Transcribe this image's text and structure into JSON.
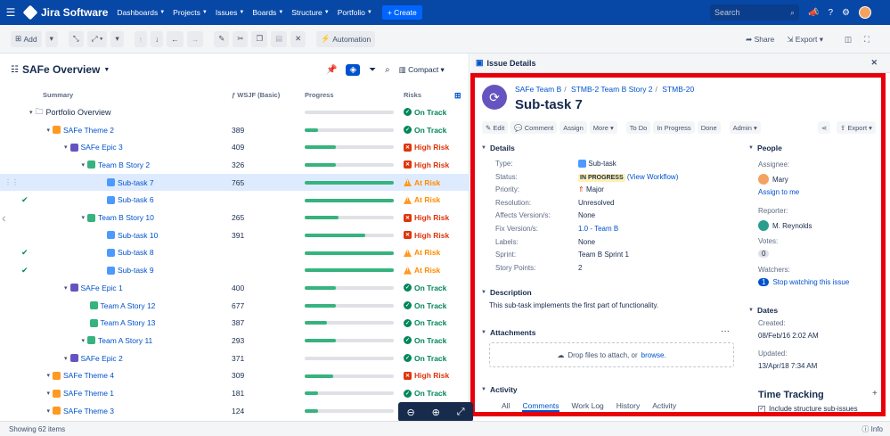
{
  "nav": {
    "brand": "Jira Software",
    "items": [
      "Dashboards",
      "Projects",
      "Issues",
      "Boards",
      "Structure",
      "Portfolio"
    ],
    "create": "+ Create",
    "search_placeholder": "Search"
  },
  "toolbar": {
    "add": "Add",
    "automation": "Automation",
    "share": "Share",
    "export": "Export"
  },
  "structure": {
    "title": "SAFe Overview",
    "view": "Compact",
    "columns": {
      "summary": "Summary",
      "wsjf": "WSJF (Basic)",
      "progress": "Progress",
      "risks": "Risks"
    },
    "rows": [
      {
        "type": "folder",
        "summary": "Portfolio Overview",
        "wsjf": "",
        "progress": 0.0,
        "risk": "On Track",
        "risk_kind": "on",
        "check": false,
        "level": 0,
        "twisty": true
      },
      {
        "type": "theme",
        "summary": "SAFe Theme 2",
        "wsjf": "389",
        "progress": 0.15,
        "risk": "On Track",
        "risk_kind": "on",
        "check": false,
        "level": 1,
        "twisty": true
      },
      {
        "type": "epic",
        "summary": "SAFe Epic 3",
        "wsjf": "409",
        "progress": 0.35,
        "risk": "High Risk",
        "risk_kind": "high",
        "check": false,
        "level": 2,
        "twisty": true
      },
      {
        "type": "story",
        "summary": "Team B Story 2",
        "wsjf": "326",
        "progress": 0.35,
        "risk": "High Risk",
        "risk_kind": "high",
        "check": false,
        "level": 3,
        "twisty": true
      },
      {
        "type": "sub",
        "summary": "Sub-task 7",
        "wsjf": "765",
        "progress": 1.0,
        "risk": "At Risk",
        "risk_kind": "at",
        "check": false,
        "level": 4,
        "twisty": false,
        "selected": true
      },
      {
        "type": "sub",
        "summary": "Sub-task 6",
        "wsjf": "",
        "progress": 1.0,
        "risk": "At Risk",
        "risk_kind": "at",
        "check": true,
        "level": 4,
        "twisty": false
      },
      {
        "type": "story",
        "summary": "Team B Story 10",
        "wsjf": "265",
        "progress": 0.38,
        "risk": "High Risk",
        "risk_kind": "high",
        "check": false,
        "level": 3,
        "twisty": true
      },
      {
        "type": "sub",
        "summary": "Sub-task 10",
        "wsjf": "391",
        "progress": 0.68,
        "risk": "High Risk",
        "risk_kind": "high",
        "check": false,
        "level": 4,
        "twisty": false
      },
      {
        "type": "sub",
        "summary": "Sub-task 8",
        "wsjf": "",
        "progress": 1.0,
        "risk": "At Risk",
        "risk_kind": "at",
        "check": true,
        "level": 4,
        "twisty": false
      },
      {
        "type": "sub",
        "summary": "Sub-task 9",
        "wsjf": "",
        "progress": 1.0,
        "risk": "At Risk",
        "risk_kind": "at",
        "check": true,
        "level": 4,
        "twisty": false
      },
      {
        "type": "epic",
        "summary": "SAFe Epic 1",
        "wsjf": "400",
        "progress": 0.35,
        "risk": "On Track",
        "risk_kind": "on",
        "check": false,
        "level": 2,
        "twisty": true
      },
      {
        "type": "story",
        "summary": "Team A Story 12",
        "wsjf": "677",
        "progress": 0.35,
        "risk": "On Track",
        "risk_kind": "on",
        "check": false,
        "level": 3,
        "twisty": false
      },
      {
        "type": "story",
        "summary": "Team A Story 13",
        "wsjf": "387",
        "progress": 0.25,
        "risk": "On Track",
        "risk_kind": "on",
        "check": false,
        "level": 3,
        "twisty": false
      },
      {
        "type": "story",
        "summary": "Team A Story 11",
        "wsjf": "293",
        "progress": 0.35,
        "risk": "On Track",
        "risk_kind": "on",
        "check": false,
        "level": 3,
        "twisty": true
      },
      {
        "type": "epic",
        "summary": "SAFe Epic 2",
        "wsjf": "371",
        "progress": 0.0,
        "risk": "On Track",
        "risk_kind": "on",
        "check": false,
        "level": 2,
        "twisty": true
      },
      {
        "type": "theme",
        "summary": "SAFe Theme 4",
        "wsjf": "309",
        "progress": 0.32,
        "risk": "High Risk",
        "risk_kind": "high",
        "check": false,
        "level": 1,
        "twisty": true
      },
      {
        "type": "theme",
        "summary": "SAFe Theme 1",
        "wsjf": "181",
        "progress": 0.15,
        "risk": "On Track",
        "risk_kind": "on",
        "check": false,
        "level": 1,
        "twisty": true
      },
      {
        "type": "theme",
        "summary": "SAFe Theme 3",
        "wsjf": "124",
        "progress": 0.15,
        "risk": "On Track",
        "risk_kind": "on",
        "check": false,
        "level": 1,
        "twisty": true
      }
    ],
    "footer": "Showing 62 items",
    "info": "Info"
  },
  "panel": {
    "header": "Issue Details",
    "breadcrumb": [
      "SAFe Team B",
      "STMB-2 Team B Story 2",
      "STMB-20"
    ],
    "title": "Sub-task 7",
    "actions": [
      "Edit",
      "Comment",
      "Assign",
      "More",
      "To Do",
      "In Progress",
      "Done",
      "Admin"
    ],
    "export": "Export",
    "details_title": "Details",
    "details": [
      {
        "label": "Type:",
        "value": "Sub-task"
      },
      {
        "label": "Status:",
        "value": "IN PROGRESS",
        "extra": "(View Workflow)"
      },
      {
        "label": "Priority:",
        "value": "Major"
      },
      {
        "label": "Resolution:",
        "value": "Unresolved"
      },
      {
        "label": "Affects Version/s:",
        "value": "None"
      },
      {
        "label": "Fix Version/s:",
        "value": "1.0 - Team B"
      },
      {
        "label": "Labels:",
        "value": "None"
      },
      {
        "label": "Sprint:",
        "value": "Team B Sprint 1"
      },
      {
        "label": "Story Points:",
        "value": "2"
      }
    ],
    "people_title": "People",
    "assignee_label": "Assignee:",
    "assignee": "Mary",
    "assign_me": "Assign to me",
    "reporter_label": "Reporter:",
    "reporter": "M. Reynolds",
    "votes_label": "Votes:",
    "votes": "0",
    "watchers_label": "Watchers:",
    "watchers": "1",
    "stop_watching": "Stop watching this issue",
    "description_title": "Description",
    "description": "This sub-task implements the first part of functionality.",
    "attachments_title": "Attachments",
    "drop_text": "Drop files to attach, or",
    "browse": "browse.",
    "dates_title": "Dates",
    "created_label": "Created:",
    "created": "08/Feb/16 2:02 AM",
    "updated_label": "Updated:",
    "updated": "13/Apr/18 7:34 AM",
    "time_tracking": "Time Tracking",
    "include_sub": "Include structure sub-issues",
    "activity_title": "Activity",
    "tabs": [
      "All",
      "Comments",
      "Work Log",
      "History",
      "Activity"
    ]
  }
}
